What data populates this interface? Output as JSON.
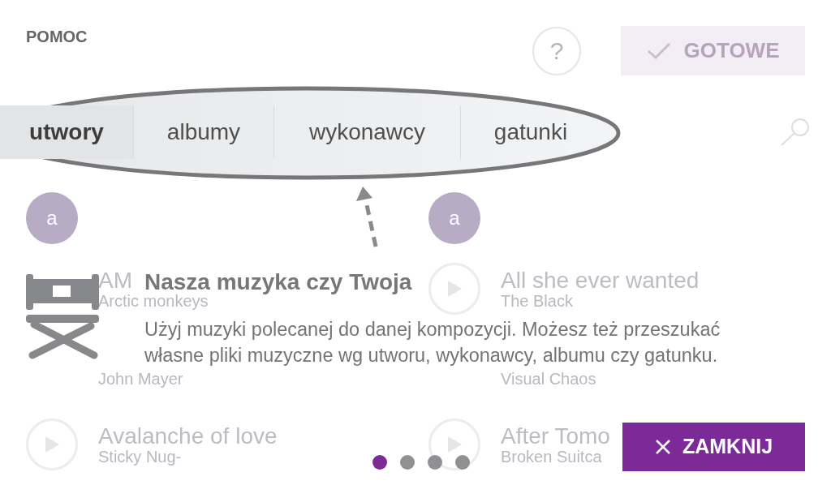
{
  "header": {
    "title": "POMOC",
    "help_label": "?",
    "done_label": "GOTOWE"
  },
  "tabs": [
    {
      "label": "utwory",
      "selected": true
    },
    {
      "label": "albumy",
      "selected": false
    },
    {
      "label": "wykonawcy",
      "selected": false
    },
    {
      "label": "gatunki",
      "selected": false
    }
  ],
  "columns": [
    {
      "letter": "a",
      "tracks": [
        {
          "title": "AM",
          "artist": "Arctic monkeys"
        },
        {
          "artist": "John Mayer"
        },
        {
          "title": "Avalanche of love",
          "artist": "Sticky Nug-"
        }
      ]
    },
    {
      "letter": "a",
      "tracks": [
        {
          "title": "All she ever wanted",
          "artist": "The Black"
        },
        {
          "artist": "Visual Chaos"
        },
        {
          "title": "After Tomo",
          "artist": "Broken Suitca"
        }
      ]
    }
  ],
  "tip": {
    "title": "Nasza muzyka czy Twoja",
    "body_lines": [
      "Użyj muzyki polecanej do danej kompozycji. Możesz też przeszukać",
      "własne pliki muzyczne wg utworu, wykonawcy, albumu czy gatunku."
    ]
  },
  "pager": [
    {
      "selected": true
    },
    {
      "selected": false
    },
    {
      "selected": false
    },
    {
      "selected": false
    }
  ],
  "close_button": {
    "label": "ZAMKNIJ"
  }
}
